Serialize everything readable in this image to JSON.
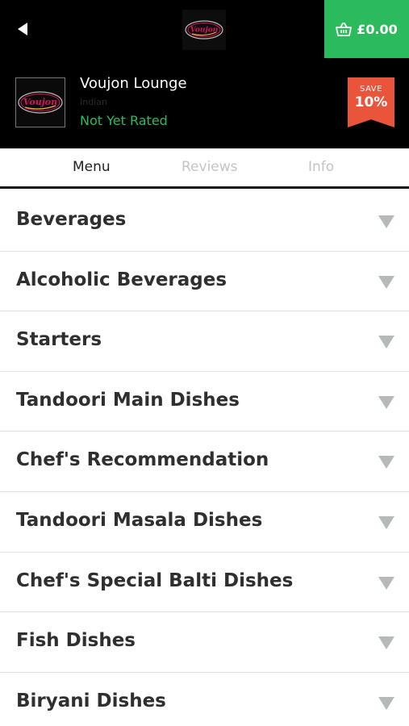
{
  "header": {
    "back_icon": "back-arrow-icon",
    "logo_text": "Voujon",
    "basket_icon": "basket-icon",
    "basket_total": "£0.00"
  },
  "restaurant": {
    "name": "Voujon Lounge",
    "cuisine": "Indian",
    "rating": "Not Yet Rated",
    "logo_text": "Voujon",
    "save_label": "SAVE",
    "save_value": "10%"
  },
  "tabs": [
    {
      "label": "Menu",
      "active": true
    },
    {
      "label": "Reviews",
      "active": false
    },
    {
      "label": "Info",
      "active": false
    }
  ],
  "menu": {
    "expand_icon": "chevron-down-icon",
    "categories": [
      "Beverages",
      "Alcoholic Beverages",
      "Starters",
      "Tandoori Main Dishes",
      "Chef's Recommendation",
      "Tandoori Masala Dishes",
      "Chef's Special Balti Dishes",
      "Fish Dishes",
      "Biryani Dishes"
    ]
  },
  "colors": {
    "header_bg": "#000000",
    "accent_green": "#2bbb5c",
    "save_red": "#e9543a",
    "chevron_gray": "#b5b9bb"
  }
}
